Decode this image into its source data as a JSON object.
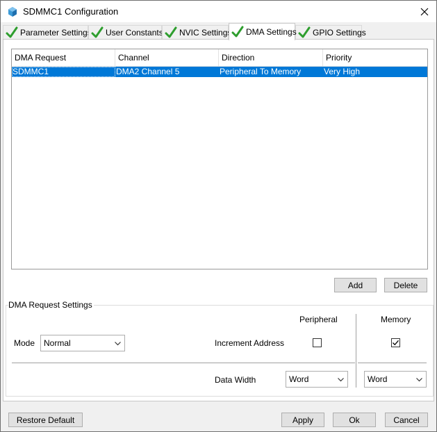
{
  "window": {
    "title": "SDMMC1 Configuration"
  },
  "tabs": [
    {
      "label": "Parameter Settings",
      "active": false
    },
    {
      "label": "User Constants",
      "active": false
    },
    {
      "label": "NVIC Settings",
      "active": false
    },
    {
      "label": "DMA Settings",
      "active": true
    },
    {
      "label": "GPIO Settings",
      "active": false
    }
  ],
  "table": {
    "headers": [
      "DMA Request",
      "Channel",
      "Direction",
      "Priority"
    ],
    "rows": [
      [
        "SDMMC1",
        "DMA2 Channel 5",
        "Peripheral To Memory",
        "Very High"
      ]
    ],
    "selected_color": "#0078d7"
  },
  "table_actions": {
    "add": "Add",
    "delete": "Delete"
  },
  "request_settings": {
    "title": "DMA Request Settings",
    "mode_label": "Mode",
    "mode_value": "Normal",
    "peripheral_header": "Peripheral",
    "memory_header": "Memory",
    "increment_label": "Increment Address",
    "peripheral_increment": false,
    "memory_increment": true,
    "data_width_label": "Data Width",
    "peripheral_width": "Word",
    "memory_width": "Word"
  },
  "footer": {
    "restore": "Restore Default",
    "apply": "Apply",
    "ok": "Ok",
    "cancel": "Cancel"
  },
  "icons": {
    "app": "stm32-cube-icon",
    "tab_status": "green-check-icon",
    "combo": "chevron-down-icon",
    "close": "close-icon"
  }
}
